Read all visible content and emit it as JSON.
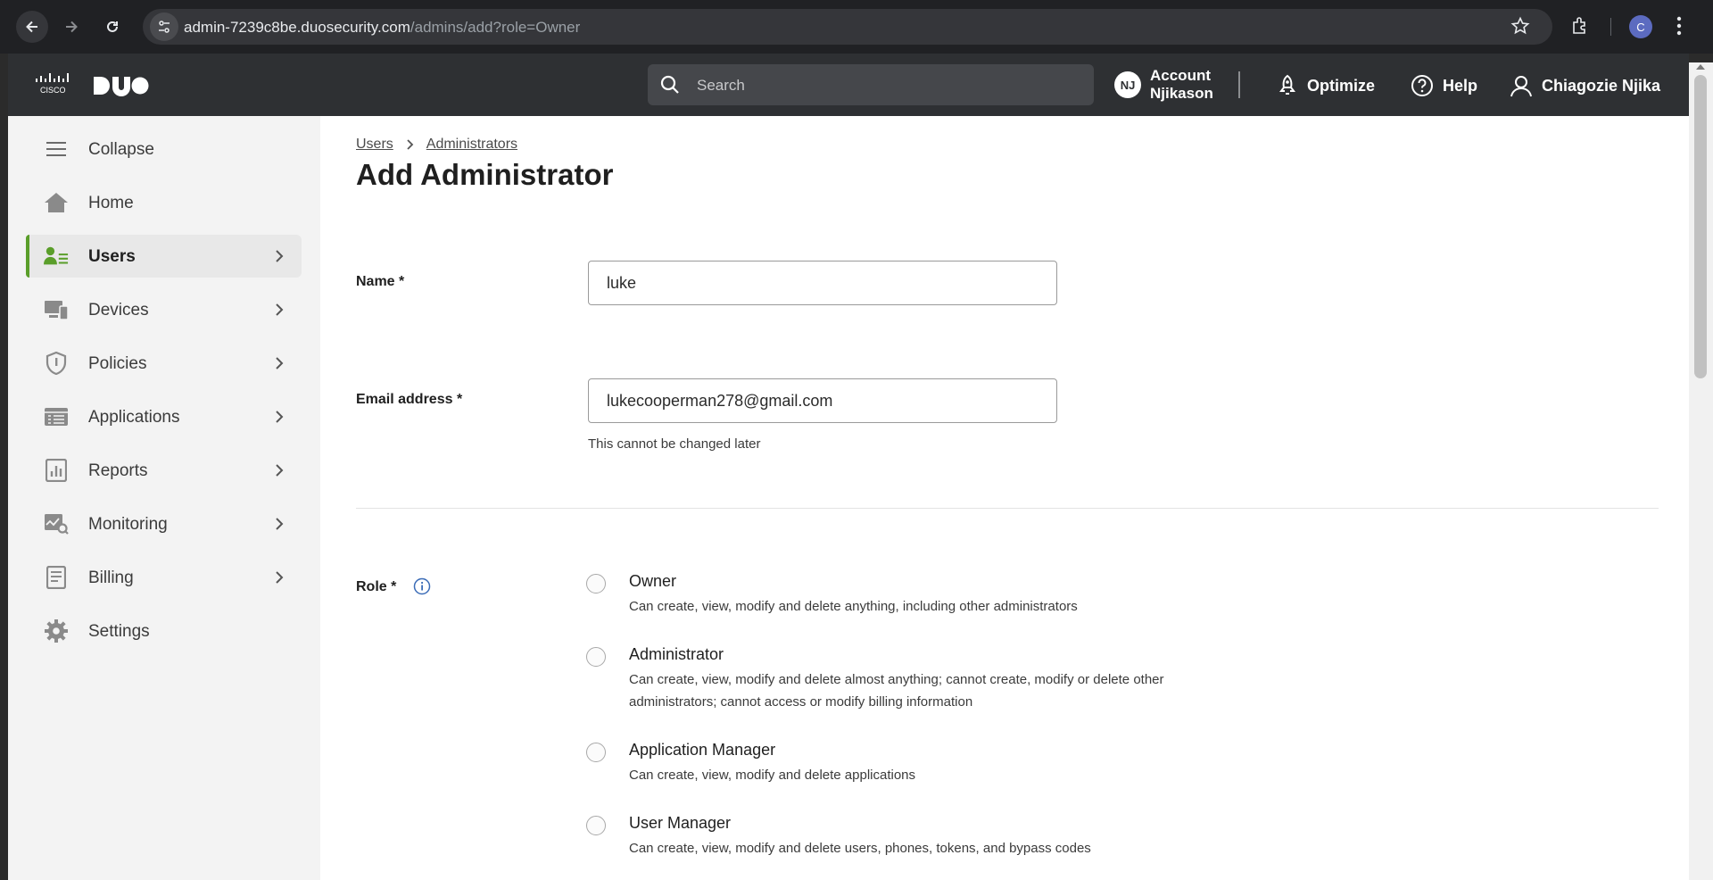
{
  "browser": {
    "url_host": "admin-7239c8be.duosecurity.com",
    "url_path": "/admins/add?role=Owner",
    "profile_initial": "C"
  },
  "topbar": {
    "search_placeholder": "Search",
    "account_badge": "NJ",
    "account_label_line1": "Account",
    "account_label_line2": "Njikason",
    "optimize_label": "Optimize",
    "help_label": "Help",
    "user_name": "Chiagozie Njika"
  },
  "sidebar": {
    "items": [
      {
        "label": "Collapse",
        "icon": "hamburger-icon"
      },
      {
        "label": "Home",
        "icon": "home-icon"
      },
      {
        "label": "Users",
        "icon": "users-icon",
        "active": true
      },
      {
        "label": "Devices",
        "icon": "devices-icon"
      },
      {
        "label": "Policies",
        "icon": "shield-icon"
      },
      {
        "label": "Applications",
        "icon": "applications-icon"
      },
      {
        "label": "Reports",
        "icon": "reports-icon"
      },
      {
        "label": "Monitoring",
        "icon": "monitoring-icon"
      },
      {
        "label": "Billing",
        "icon": "billing-icon"
      },
      {
        "label": "Settings",
        "icon": "gear-icon"
      }
    ]
  },
  "breadcrumb": {
    "items": [
      "Users",
      "Administrators"
    ]
  },
  "page_title": "Add Administrator",
  "form": {
    "name_label": "Name",
    "name_value": "luke",
    "email_label": "Email address",
    "email_value": "lukecooperman278@gmail.com",
    "email_hint": "This cannot be changed later",
    "required_marker": "*",
    "role_label": "Role",
    "roles": [
      {
        "name": "Owner",
        "description": "Can create, view, modify and delete anything, including other administrators"
      },
      {
        "name": "Administrator",
        "description": "Can create, view, modify and delete almost anything; cannot create, modify or delete other administrators; cannot access or modify billing information"
      },
      {
        "name": "Application Manager",
        "description": "Can create, view, modify and delete applications"
      },
      {
        "name": "User Manager",
        "description": "Can create, view, modify and delete users, phones, tokens, and bypass codes"
      }
    ]
  },
  "colors": {
    "accent_green": "#5a9e2a",
    "topbar_bg": "#2e3033",
    "sidebar_bg": "#f3f3f3"
  }
}
